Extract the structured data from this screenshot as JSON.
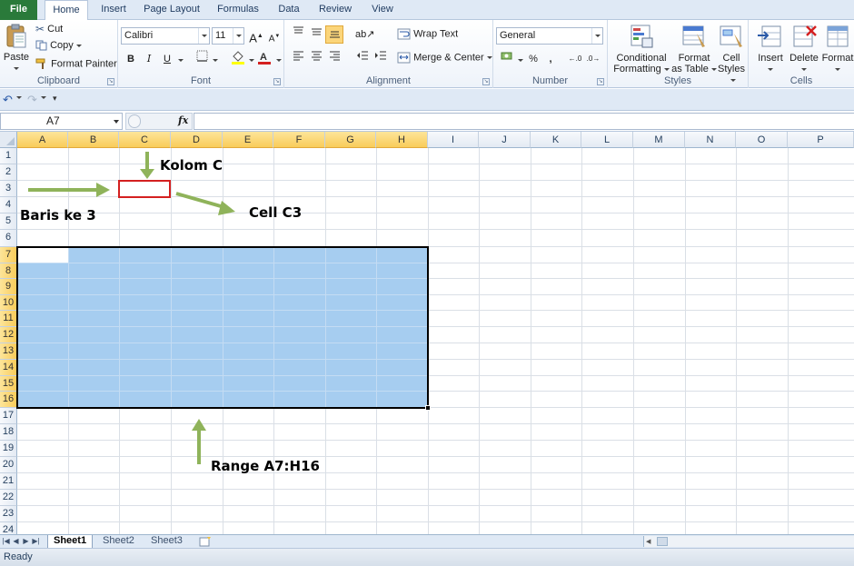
{
  "ribbon_tabs": [
    "File",
    "Home",
    "Insert",
    "Page Layout",
    "Formulas",
    "Data",
    "Review",
    "View"
  ],
  "active_tab": "Home",
  "clipboard": {
    "paste": "Paste",
    "cut": "Cut",
    "copy": "Copy",
    "format_painter": "Format Painter",
    "label": "Clipboard"
  },
  "font": {
    "name": "Calibri",
    "size": "11",
    "bold": "B",
    "italic": "I",
    "underline": "U",
    "label": "Font",
    "fill_color": "#ffff00",
    "font_color": "#d42020"
  },
  "alignment": {
    "wrap_text": "Wrap Text",
    "merge_center": "Merge & Center",
    "label": "Alignment"
  },
  "number": {
    "format": "General",
    "percent": "%",
    "comma": ",",
    "label": "Number"
  },
  "styles": {
    "conditional": [
      "Conditional",
      "Formatting"
    ],
    "format_table": [
      "Format",
      "as Table"
    ],
    "cell_styles": [
      "Cell",
      "Styles"
    ],
    "label": "Styles"
  },
  "cells": {
    "insert": "Insert",
    "delete": "Delete",
    "format": "Format",
    "label": "Cells"
  },
  "formula_bar": {
    "name_box": "A7",
    "fx": "fx",
    "value": ""
  },
  "columns": [
    "A",
    "B",
    "C",
    "D",
    "E",
    "F",
    "G",
    "H",
    "I",
    "J",
    "K",
    "L",
    "M",
    "N",
    "O",
    "P"
  ],
  "selected_columns": [
    "A",
    "B",
    "C",
    "D",
    "E",
    "F",
    "G",
    "H"
  ],
  "rows": [
    "1",
    "2",
    "3",
    "4",
    "5",
    "6",
    "7",
    "8",
    "9",
    "10",
    "11",
    "12",
    "13",
    "14",
    "15",
    "16",
    "17",
    "18",
    "19",
    "20",
    "21",
    "22",
    "23",
    "24"
  ],
  "selected_rows": [
    "7",
    "8",
    "9",
    "10",
    "11",
    "12",
    "13",
    "14",
    "15",
    "16"
  ],
  "annotations": {
    "kolom": "Kolom C",
    "baris": "Baris ke 3",
    "cell": "Cell C3",
    "range": "Range A7:H16",
    "arrow_color": "#8fb35a"
  },
  "selection_color": "#a6cdf0",
  "sheets": [
    "Sheet1",
    "Sheet2",
    "Sheet3"
  ],
  "active_sheet": "Sheet1",
  "status": "Ready"
}
